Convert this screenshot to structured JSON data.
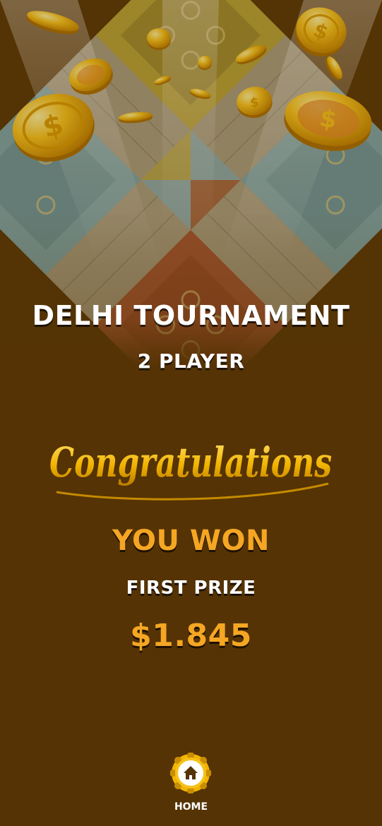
{
  "tournament": {
    "title": "DELHI TOURNAMENT",
    "mode": "2 PLAYER"
  },
  "result": {
    "congratulations": "Congratulations",
    "headline": "YOU WON",
    "prize_label": "FIRST PRIZE",
    "prize_amount": "$1.845"
  },
  "nav": {
    "home_label": "HOME",
    "home_icon": "home-icon"
  },
  "colors": {
    "background": "#553304",
    "accent": "#f5a623",
    "coin": "#f2b400"
  }
}
